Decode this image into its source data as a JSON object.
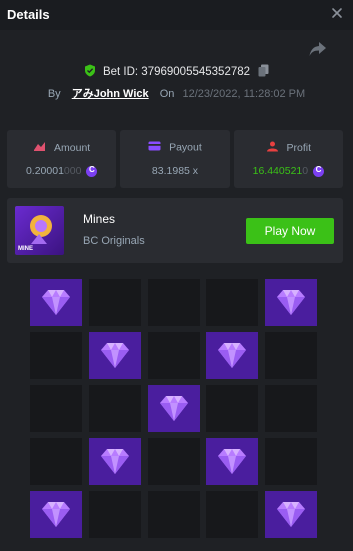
{
  "window": {
    "title": "Details"
  },
  "bet": {
    "id_label": "Bet ID: 37969005545352782",
    "by_label": "By",
    "user": "アみJohn Wick",
    "on_label": "On",
    "date": "12/23/2022, 11:28:02 PM"
  },
  "stats": {
    "amount": {
      "label": "Amount",
      "value_main": "0.20001",
      "value_dim": "000"
    },
    "payout": {
      "label": "Payout",
      "value": "83.1985 x"
    },
    "profit": {
      "label": "Profit",
      "value_main": "16.440521",
      "value_dim": "0"
    }
  },
  "game": {
    "name": "Mines",
    "provider": "BC Originals",
    "play_label": "Play Now",
    "thumb_text": "MINE"
  },
  "board": {
    "rows": 5,
    "cols": 5,
    "cells": [
      [
        "gem",
        "empty",
        "empty",
        "empty",
        "gem"
      ],
      [
        "empty",
        "gem",
        "empty",
        "gem",
        "empty"
      ],
      [
        "empty",
        "empty",
        "gem",
        "empty",
        "empty"
      ],
      [
        "empty",
        "gem",
        "empty",
        "gem",
        "empty"
      ],
      [
        "gem",
        "empty",
        "empty",
        "empty",
        "gem"
      ]
    ]
  },
  "colors": {
    "accent_green": "#3bc117",
    "gem_bg": "#4a1e9e",
    "coin": "#7b3ff2",
    "amount_icon": "#e0526f",
    "payout_icon": "#8a4dff",
    "profit_icon": "#e84040"
  },
  "icons": [
    "close-icon",
    "share-icon",
    "shield-check-icon",
    "copy-icon",
    "amount-icon",
    "payout-icon",
    "profit-icon",
    "coin-icon",
    "gem-icon"
  ]
}
